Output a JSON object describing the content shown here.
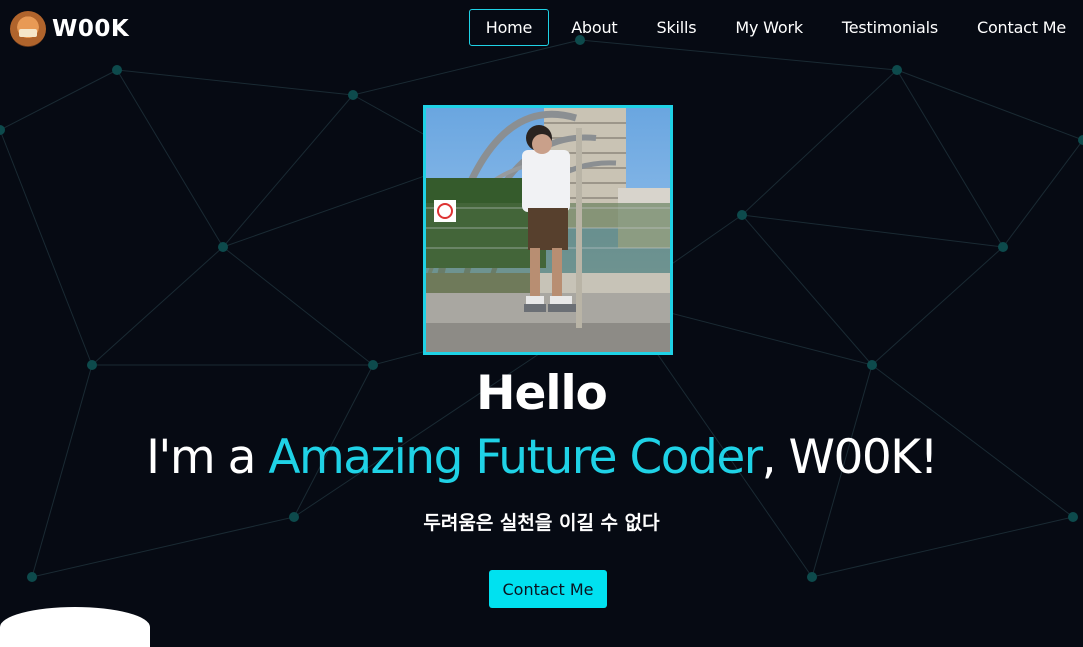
{
  "brand": {
    "name": "W00K",
    "logo_icon": "mascot-logo-icon"
  },
  "nav": {
    "items": [
      {
        "label": "Home",
        "active": true
      },
      {
        "label": "About",
        "active": false
      },
      {
        "label": "Skills",
        "active": false
      },
      {
        "label": "My Work",
        "active": false
      },
      {
        "label": "Testimonials",
        "active": false
      },
      {
        "label": "Contact Me",
        "active": false
      }
    ]
  },
  "hero": {
    "greeting": "Hello",
    "intro_prefix": "I'm a ",
    "intro_highlight": "Amazing Future Coder",
    "intro_suffix": ", W00K!",
    "tagline": "두려움은 실천을 이길 수 없다",
    "cta_label": "Contact Me"
  },
  "colors": {
    "background": "#060a13",
    "accent": "#1fd2e6",
    "cta_background": "#00e1f0",
    "network_lines": "#1a2a33",
    "network_nodes": "#0d4a4c"
  }
}
